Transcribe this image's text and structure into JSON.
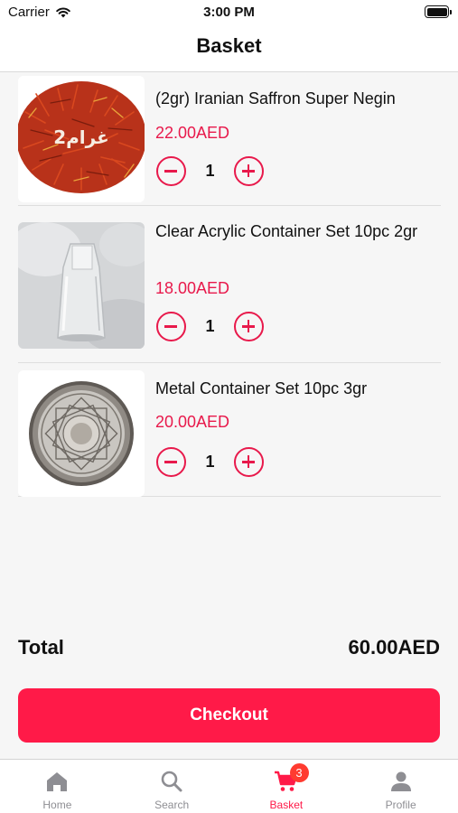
{
  "status_bar": {
    "carrier": "Carrier",
    "time": "3:00 PM"
  },
  "nav": {
    "title": "Basket"
  },
  "basket_items": [
    {
      "name": "(2gr) Iranian Saffron Super Negin",
      "price": "22.00AED",
      "quantity": "1",
      "image_label": "2غرام"
    },
    {
      "name": "Clear Acrylic Container Set 10pc 2gr",
      "price": "18.00AED",
      "quantity": "1"
    },
    {
      "name": "Metal Container Set 10pc 3gr",
      "price": "20.00AED",
      "quantity": "1"
    }
  ],
  "summary": {
    "total_label": "Total",
    "total_value": "60.00AED"
  },
  "checkout": {
    "label": "Checkout"
  },
  "tab_bar": {
    "items": [
      {
        "label": "Home",
        "icon": "home-icon"
      },
      {
        "label": "Search",
        "icon": "search-icon"
      },
      {
        "label": "Basket",
        "icon": "cart-icon",
        "badge": "3",
        "active": true
      },
      {
        "label": "Profile",
        "icon": "person-icon"
      }
    ]
  },
  "colors": {
    "accent": "#ff1a48",
    "price": "#e8194b",
    "tab_inactive": "#8e8e93",
    "badge": "#ff3b30"
  }
}
